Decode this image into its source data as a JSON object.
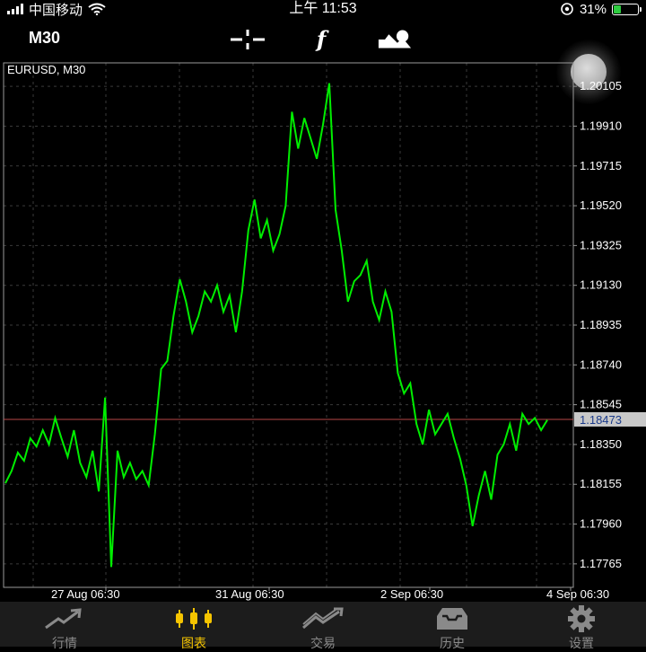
{
  "status_bar": {
    "carrier": "中国移动",
    "time": "上午 11:53",
    "battery_text": "31%",
    "battery_level": 0.31
  },
  "toolbar": {
    "timeframe": "M30",
    "icons": [
      "crosshair-icon",
      "function-icon",
      "objects-icon"
    ]
  },
  "chart": {
    "label": "EURUSD, M30",
    "current_price": "1.18473",
    "price_line_color": "#b94848",
    "series_color": "#00ee00",
    "grid_color": "#3a3a3a"
  },
  "chart_data": {
    "type": "line",
    "title": "EURUSD, M30",
    "xlabel": "",
    "ylabel": "",
    "ylim": [
      1.1765,
      1.2022
    ],
    "y_ticks": [
      "1.20105",
      "1.19910",
      "1.19715",
      "1.19520",
      "1.19325",
      "1.19130",
      "1.18935",
      "1.18740",
      "1.18545",
      "1.18350",
      "1.18155",
      "1.17960",
      "1.17765"
    ],
    "x_ticks": [
      "27 Aug 06:30",
      "31 Aug 06:30",
      "2 Sep 06:30",
      "4 Sep 06:30"
    ],
    "grid": true,
    "series": [
      {
        "values": [
          1.1816,
          1.1822,
          1.1831,
          1.1827,
          1.1838,
          1.1834,
          1.1842,
          1.1835,
          1.1848,
          1.1838,
          1.1829,
          1.1842,
          1.1826,
          1.1819,
          1.1832,
          1.1812,
          1.1858,
          1.1775,
          1.1832,
          1.1819,
          1.1826,
          1.1818,
          1.1822,
          1.1815,
          1.184,
          1.1872,
          1.1876,
          1.1898,
          1.1916,
          1.1905,
          1.189,
          1.1898,
          1.191,
          1.1905,
          1.1913,
          1.19,
          1.1908,
          1.189,
          1.191,
          1.194,
          1.1955,
          1.1936,
          1.1945,
          1.193,
          1.1938,
          1.1952,
          1.1998,
          1.198,
          1.1995,
          1.1985,
          1.1975,
          1.1992,
          1.2012,
          1.195,
          1.193,
          1.1905,
          1.1915,
          1.1918,
          1.1925,
          1.1905,
          1.1896,
          1.191,
          1.19,
          1.187,
          1.186,
          1.1865,
          1.1845,
          1.1835,
          1.1852,
          1.184,
          1.1845,
          1.185,
          1.1838,
          1.1828,
          1.1815,
          1.1795,
          1.181,
          1.1822,
          1.1808,
          1.183,
          1.1835,
          1.1845,
          1.1832,
          1.185,
          1.1845,
          1.1848,
          1.1842,
          1.1847
        ]
      }
    ]
  },
  "tabs": [
    {
      "label": "行情",
      "icon": "quotes-icon",
      "active": false
    },
    {
      "label": "图表",
      "icon": "chart-icon",
      "active": true
    },
    {
      "label": "交易",
      "icon": "trade-icon",
      "active": false
    },
    {
      "label": "历史",
      "icon": "history-icon",
      "active": false
    },
    {
      "label": "设置",
      "icon": "settings-icon",
      "active": false
    }
  ]
}
